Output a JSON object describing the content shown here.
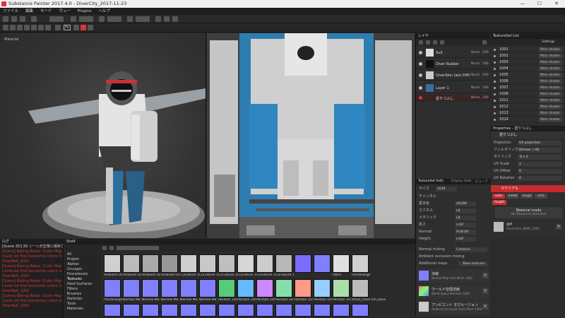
{
  "window": {
    "title": "Substance Painter 2017.4.0 - DiverCity_2017-11-23",
    "minimize": "—",
    "maximize": "☐",
    "close": "✕"
  },
  "menu": [
    "ファイル",
    "編集",
    "モード",
    "ヴュー",
    "Plugins",
    "ヘルプ"
  ],
  "toolbar": {
    "ps_label": "Ps"
  },
  "viewport3d": {
    "label": "Material"
  },
  "layers": {
    "title": "レイヤ",
    "rows": [
      {
        "name": "Suit",
        "blend": "Norm",
        "opacity": "100"
      },
      {
        "name": "Diver Rubber",
        "blend": "Norm",
        "opacity": "100"
      },
      {
        "name": "DiverSkin (w/o Diff)",
        "blend": "Norm",
        "opacity": "100"
      },
      {
        "name": "Layer 1",
        "blend": "Norm",
        "opacity": "100"
      }
    ],
    "selected_row": {
      "name": "塗りつぶし",
      "blend": "Norm",
      "opacity": "100"
    }
  },
  "texture_set_list": {
    "title": "TextureSet List",
    "settings_label": "Settings",
    "rows": [
      {
        "name": "1001",
        "shader": "Main shader"
      },
      {
        "name": "1002",
        "shader": "Main shader"
      },
      {
        "name": "1003",
        "shader": "Main shader"
      },
      {
        "name": "1004",
        "shader": "Main shader"
      },
      {
        "name": "1005",
        "shader": "Main shader"
      },
      {
        "name": "1006",
        "shader": "Main shader"
      },
      {
        "name": "1007",
        "shader": "Main shader"
      },
      {
        "name": "1008",
        "shader": "Main shader"
      },
      {
        "name": "1011",
        "shader": "Main shader"
      },
      {
        "name": "1012",
        "shader": "Main shader"
      },
      {
        "name": "1013",
        "shader": "Main shader"
      },
      {
        "name": "1014",
        "shader": "Main shader"
      }
    ]
  },
  "properties": {
    "title": "Properties - 塗りつぶし",
    "section": "塗りつぶし",
    "rows": [
      {
        "key": "Projection",
        "value": "UV projection"
      },
      {
        "key": "フィルタリング",
        "value": "Bilinear | HQ"
      },
      {
        "key": "タイリング",
        "value": "タイル"
      },
      {
        "key": "UV Scale",
        "value": "1"
      },
      {
        "key": "UV Offset",
        "value": "0"
      },
      {
        "key": "UV Rotation",
        "value": "0"
      }
    ]
  },
  "material": {
    "title": "マテリアル",
    "tabs": [
      "color",
      "metal",
      "rough",
      "nrm",
      "height"
    ],
    "mode_label": "Material mode",
    "mode_value": "No Resource Selected",
    "diff_name": "diff",
    "diff_file": "DiverSkin_BMP_1001"
  },
  "texture_set_settings": {
    "tabs": [
      "TextureSet Setti",
      "Display Setti",
      "ビューア"
    ],
    "rows": [
      {
        "key": "サイズ",
        "value": "2048"
      },
      {
        "key": "チャンネル",
        "value": ""
      },
      {
        "key": "基本色",
        "value": "sRGB8"
      },
      {
        "key": "ラフネス",
        "value": "L8"
      },
      {
        "key": "メタリック",
        "value": "L8"
      },
      {
        "key": "高さ",
        "value": "L16F"
      },
      {
        "key": "Normal",
        "value": "RGB16F"
      },
      {
        "key": "Height",
        "value": "L16F"
      }
    ],
    "normal_mixing_label": "Normal mixing",
    "normal_mixing_value": "Combine",
    "ao_mixing_label": "Ambient occlusion mixing",
    "additional_maps_label": "Additional maps",
    "bake_button": "Bake textures",
    "map_items": [
      {
        "name": "法線",
        "file": "Normal Map from Mesh 1002"
      },
      {
        "name": "ワールド空間法線",
        "file": "World Space Normals 1002"
      },
      {
        "name": "アンビエント オクルージョン",
        "file": "Ambient Occlusion from Mesh 1002"
      }
    ]
  },
  "log": {
    "title": "ログ",
    "lines": [
      {
        "text": "[Scene 3D] 3D シーンが正常に保存されました。",
        "kind": "info"
      },
      {
        "text": "[Scene] Baking Rebar: (Color Map from Mesh)",
        "kind": "error"
      },
      {
        "text": "Could not find bonvertex colors in mesh",
        "kind": "error"
      },
      {
        "text": "DiverBelt_1002",
        "kind": "error"
      },
      {
        "text": "[Scene] Baking Rebar: (Color Map from Mesh)",
        "kind": "error"
      },
      {
        "text": "Could not find bonvertex colors in mesh",
        "kind": "error"
      },
      {
        "text": "DiverBelt_1002",
        "kind": "error"
      },
      {
        "text": "[Scene] Baking Rebar: (Color Map from Mesh)",
        "kind": "error"
      },
      {
        "text": "Could not find bonvertex colors in mesh",
        "kind": "error"
      },
      {
        "text": "DiverBelt_1002",
        "kind": "error"
      },
      {
        "text": "[Scene] Baking Rebar: (Color Map from Mesh)",
        "kind": "error"
      },
      {
        "text": "Could not find bonvertex colors in mesh",
        "kind": "error"
      },
      {
        "text": "DiverBelt_1002",
        "kind": "error"
      }
    ]
  },
  "shelf": {
    "title": "Shelf",
    "categories": [
      "All",
      "Project",
      "Alphas",
      "Grunges",
      "Procedurals",
      "Textures",
      "Hard Surfaces",
      "Filters",
      "Brushes",
      "Particles",
      "Tools",
      "Materials"
    ],
    "row1": [
      "Ambient Oc...",
      "Ambient Oc...",
      "Ambient Oc...",
      "Ambient Oc...",
      "Curvature 1...",
      "Curvature 1...",
      "Curvature 1...",
      "Curvature 1...",
      "Curvature 1...",
      "Curvature 1...",
      "",
      "",
      "fabric",
      "fronterange..."
    ],
    "row2": [
      "fronterange...",
      "Normal Ma...",
      "Normal Ma...",
      "Normal Ma...",
      "Normal Ma...",
      "Normal Ma...",
      "Position 1001",
      "Position 1002",
      "Position 1003",
      "Position 1011",
      "Position 1014",
      "Position 1015",
      "Position 1016",
      "sheet_noise"
    ],
    "row2_extra": "sim_back"
  }
}
